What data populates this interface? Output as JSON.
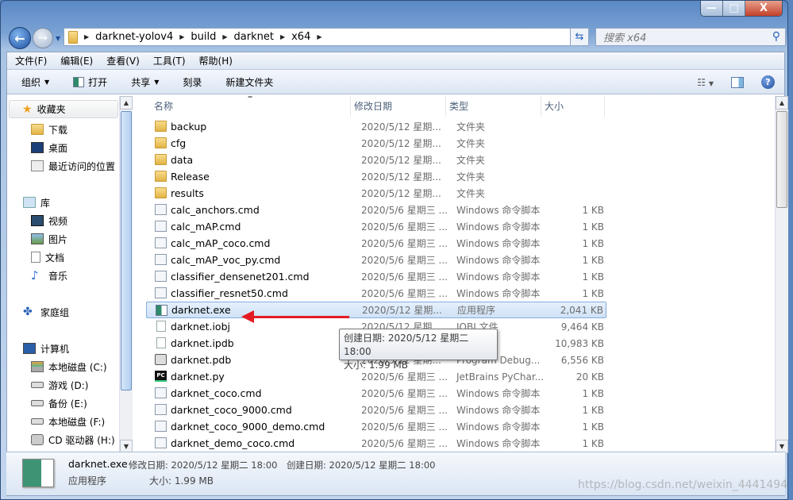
{
  "window": {
    "minimize": "—",
    "maximize": "□",
    "close": "X"
  },
  "address": {
    "segments": [
      "darknet-yolov4",
      "build",
      "darknet",
      "x64"
    ]
  },
  "search": {
    "placeholder": "搜索 x64"
  },
  "menu": [
    "文件(F)",
    "编辑(E)",
    "查看(V)",
    "工具(T)",
    "帮助(H)"
  ],
  "toolbar": {
    "organize": "组织",
    "open": "打开",
    "share": "共享",
    "burn": "刻录",
    "new_folder": "新建文件夹"
  },
  "sidebar": {
    "favorites": "收藏夹",
    "favorites_items": [
      "下载",
      "桌面",
      "最近访问的位置"
    ],
    "libraries": "库",
    "libraries_items": [
      "视频",
      "图片",
      "文档",
      "音乐"
    ],
    "homegroup": "家庭组",
    "computer": "计算机",
    "drives": [
      "本地磁盘 (C:)",
      "游戏 (D:)",
      "备份 (E:)",
      "本地磁盘 (F:)",
      "CD 驱动器 (H:)"
    ]
  },
  "columns": [
    "名称",
    "修改日期",
    "类型",
    "大小"
  ],
  "files": [
    {
      "name": "backup",
      "date": "2020/5/12 星期...",
      "type": "文件夹",
      "size": "",
      "icon": "folder"
    },
    {
      "name": "cfg",
      "date": "2020/5/12 星期...",
      "type": "文件夹",
      "size": "",
      "icon": "folder"
    },
    {
      "name": "data",
      "date": "2020/5/12 星期...",
      "type": "文件夹",
      "size": "",
      "icon": "folder"
    },
    {
      "name": "Release",
      "date": "2020/5/12 星期...",
      "type": "文件夹",
      "size": "",
      "icon": "folder"
    },
    {
      "name": "results",
      "date": "2020/5/12 星期...",
      "type": "文件夹",
      "size": "",
      "icon": "folder"
    },
    {
      "name": "calc_anchors.cmd",
      "date": "2020/5/6 星期三 ...",
      "type": "Windows 命令脚本",
      "size": "1 KB",
      "icon": "cmd"
    },
    {
      "name": "calc_mAP.cmd",
      "date": "2020/5/6 星期三 ...",
      "type": "Windows 命令脚本",
      "size": "1 KB",
      "icon": "cmd"
    },
    {
      "name": "calc_mAP_coco.cmd",
      "date": "2020/5/6 星期三 ...",
      "type": "Windows 命令脚本",
      "size": "1 KB",
      "icon": "cmd"
    },
    {
      "name": "calc_mAP_voc_py.cmd",
      "date": "2020/5/6 星期三 ...",
      "type": "Windows 命令脚本",
      "size": "1 KB",
      "icon": "cmd"
    },
    {
      "name": "classifier_densenet201.cmd",
      "date": "2020/5/6 星期三 ...",
      "type": "Windows 命令脚本",
      "size": "1 KB",
      "icon": "cmd"
    },
    {
      "name": "classifier_resnet50.cmd",
      "date": "2020/5/6 星期三 ...",
      "type": "Windows 命令脚本",
      "size": "1 KB",
      "icon": "cmd"
    },
    {
      "name": "darknet.exe",
      "date": "2020/5/12 星期...",
      "type": "应用程序",
      "size": "2,041 KB",
      "icon": "exe",
      "selected": true
    },
    {
      "name": "darknet.iobj",
      "date": "2020/5/12 星期...",
      "type": "IOBJ 文件",
      "size": "9,464 KB",
      "icon": "doc"
    },
    {
      "name": "darknet.ipdb",
      "date": "",
      "type": "",
      "size": "10,983 KB",
      "icon": "doc"
    },
    {
      "name": "darknet.pdb",
      "date": "2020/5/12 星期...",
      "type": "Program Debug...",
      "size": "6,556 KB",
      "icon": "pdb"
    },
    {
      "name": "darknet.py",
      "date": "2020/5/6 星期三 ...",
      "type": "JetBrains PyChar...",
      "size": "20 KB",
      "icon": "pc"
    },
    {
      "name": "darknet_coco.cmd",
      "date": "2020/5/6 星期三 ...",
      "type": "Windows 命令脚本",
      "size": "1 KB",
      "icon": "cmd"
    },
    {
      "name": "darknet_coco_9000.cmd",
      "date": "2020/5/6 星期三 ...",
      "type": "Windows 命令脚本",
      "size": "1 KB",
      "icon": "cmd"
    },
    {
      "name": "darknet_coco_9000_demo.cmd",
      "date": "2020/5/6 星期三 ...",
      "type": "Windows 命令脚本",
      "size": "1 KB",
      "icon": "cmd"
    },
    {
      "name": "darknet_demo_coco.cmd",
      "date": "2020/5/6 星期三 ...",
      "type": "Windows 命令脚本",
      "size": "1 KB",
      "icon": "cmd"
    }
  ],
  "tooltip": {
    "line1": "创建日期: 2020/5/12 星期二 18:00",
    "line2": "大小: 1.99 MB"
  },
  "details": {
    "name": "darknet.exe",
    "modified": "修改日期: 2020/5/12 星期二 18:00",
    "created": "创建日期: 2020/5/12 星期二 18:00",
    "type": "应用程序",
    "size": "大小: 1.99 MB"
  },
  "watermark": "https://blog.csdn.net/weixin_4441494",
  "colors": {
    "accent": "#e51b24",
    "selection": "#cfe2f7"
  }
}
